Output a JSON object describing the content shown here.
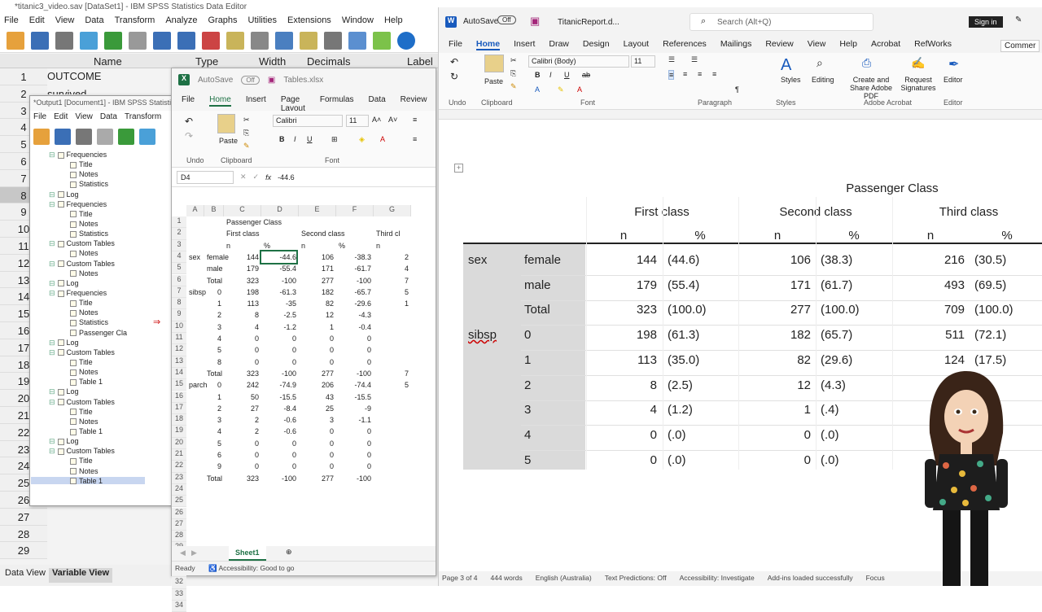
{
  "spss": {
    "title": "*titanic3_video.sav [DataSet1] - IBM SPSS Statistics Data Editor",
    "menu": [
      "File",
      "Edit",
      "View",
      "Data",
      "Transform",
      "Analyze",
      "Graphs",
      "Utilities",
      "Extensions",
      "Window",
      "Help"
    ],
    "columns": [
      "Name",
      "Type",
      "Width",
      "Decimals",
      "Label"
    ],
    "row_numbers": [
      "1",
      "2",
      "3",
      "4",
      "5",
      "6",
      "7",
      "8",
      "9",
      "10",
      "11",
      "12",
      "13",
      "14",
      "15",
      "16",
      "17",
      "18",
      "19",
      "20",
      "21",
      "22",
      "23",
      "24",
      "25",
      "26",
      "27",
      "28",
      "29"
    ],
    "cell_r1": "OUTCOME",
    "cell_r2": "survived",
    "tabs": [
      "Data View",
      "Variable View"
    ]
  },
  "viewer": {
    "title": "*Output1 [Document1] - IBM SPSS Statistics",
    "menu": [
      "File",
      "Edit",
      "View",
      "Data",
      "Transform"
    ],
    "tree": [
      {
        "label": "Frequencies",
        "level": 1
      },
      {
        "label": "Title",
        "level": 2
      },
      {
        "label": "Notes",
        "level": 2
      },
      {
        "label": "Statistics",
        "level": 2
      },
      {
        "label": "Log",
        "level": 1
      },
      {
        "label": "Frequencies",
        "level": 1
      },
      {
        "label": "Title",
        "level": 2
      },
      {
        "label": "Notes",
        "level": 2
      },
      {
        "label": "Statistics",
        "level": 2
      },
      {
        "label": "Custom Tables",
        "level": 1
      },
      {
        "label": "Notes",
        "level": 2
      },
      {
        "label": "Custom Tables",
        "level": 1
      },
      {
        "label": "Notes",
        "level": 2
      },
      {
        "label": "Log",
        "level": 1
      },
      {
        "label": "Frequencies",
        "level": 1
      },
      {
        "label": "Title",
        "level": 2
      },
      {
        "label": "Notes",
        "level": 2
      },
      {
        "label": "Statistics",
        "level": 2
      },
      {
        "label": "Passenger Cla",
        "level": 2
      },
      {
        "label": "Log",
        "level": 1
      },
      {
        "label": "Custom Tables",
        "level": 1
      },
      {
        "label": "Title",
        "level": 2
      },
      {
        "label": "Notes",
        "level": 2
      },
      {
        "label": "Table 1",
        "level": 2
      },
      {
        "label": "Log",
        "level": 1
      },
      {
        "label": "Custom Tables",
        "level": 1
      },
      {
        "label": "Title",
        "level": 2
      },
      {
        "label": "Notes",
        "level": 2
      },
      {
        "label": "Table 1",
        "level": 2
      },
      {
        "label": "Log",
        "level": 1
      },
      {
        "label": "Custom Tables",
        "level": 1
      },
      {
        "label": "Title",
        "level": 2
      },
      {
        "label": "Notes",
        "level": 2
      },
      {
        "label": "Table 1",
        "level": 2
      }
    ]
  },
  "excel": {
    "autosave": "AutoSave",
    "autosave_state": "Off",
    "filename": "Tables.xlsx",
    "menu": [
      "File",
      "Home",
      "Insert",
      "Page Layout",
      "Formulas",
      "Data",
      "Review"
    ],
    "font": "Calibri",
    "size": "11",
    "groups": [
      "Undo",
      "Clipboard",
      "Font"
    ],
    "paste": "Paste",
    "namebox": "D4",
    "formula": "-44.6",
    "columns": [
      "A",
      "B",
      "C",
      "D",
      "E",
      "F",
      "G"
    ],
    "rows": [
      [
        "",
        "",
        "Passenger Class",
        "",
        "",
        "",
        ""
      ],
      [
        "",
        "",
        "First class",
        "",
        "Second class",
        "",
        "Third cl"
      ],
      [
        "",
        "",
        "n",
        "%",
        "n",
        "%",
        "n"
      ],
      [
        "sex",
        "female",
        "144",
        "-44.6",
        "106",
        "-38.3",
        "2"
      ],
      [
        "",
        "male",
        "179",
        "-55.4",
        "171",
        "-61.7",
        "4"
      ],
      [
        "",
        "Total",
        "323",
        "-100",
        "277",
        "-100",
        "7"
      ],
      [
        "sibsp",
        "0",
        "198",
        "-61.3",
        "182",
        "-65.7",
        "5"
      ],
      [
        "",
        "1",
        "113",
        "-35",
        "82",
        "-29.6",
        "1"
      ],
      [
        "",
        "2",
        "8",
        "-2.5",
        "12",
        "-4.3",
        ""
      ],
      [
        "",
        "3",
        "4",
        "-1.2",
        "1",
        "-0.4",
        ""
      ],
      [
        "",
        "4",
        "0",
        "0",
        "0",
        "0",
        ""
      ],
      [
        "",
        "5",
        "0",
        "0",
        "0",
        "0",
        ""
      ],
      [
        "",
        "8",
        "0",
        "0",
        "0",
        "0",
        ""
      ],
      [
        "",
        "Total",
        "323",
        "-100",
        "277",
        "-100",
        "7"
      ],
      [
        "parch",
        "0",
        "242",
        "-74.9",
        "206",
        "-74.4",
        "5"
      ],
      [
        "",
        "1",
        "50",
        "-15.5",
        "43",
        "-15.5",
        ""
      ],
      [
        "",
        "2",
        "27",
        "-8.4",
        "25",
        "-9",
        ""
      ],
      [
        "",
        "3",
        "2",
        "-0.6",
        "3",
        "-1.1",
        ""
      ],
      [
        "",
        "4",
        "2",
        "-0.6",
        "0",
        "0",
        ""
      ],
      [
        "",
        "5",
        "0",
        "0",
        "0",
        "0",
        ""
      ],
      [
        "",
        "6",
        "0",
        "0",
        "0",
        "0",
        ""
      ],
      [
        "",
        "9",
        "0",
        "0",
        "0",
        "0",
        ""
      ],
      [
        "",
        "Total",
        "323",
        "-100",
        "277",
        "-100",
        ""
      ],
      [
        "",
        "",
        "",
        "",
        "",
        "",
        ""
      ],
      [
        "",
        "",
        "",
        "",
        "",
        "",
        ""
      ],
      [
        "",
        "",
        "",
        "",
        "",
        "",
        ""
      ],
      [
        "",
        "",
        "",
        "",
        "",
        "",
        ""
      ],
      [
        "",
        "",
        "",
        "",
        "",
        "",
        ""
      ],
      [
        "",
        "",
        "",
        "",
        "",
        "",
        ""
      ],
      [
        "",
        "",
        "",
        "",
        "",
        "",
        ""
      ],
      [
        "",
        "",
        "",
        "",
        "",
        "",
        ""
      ],
      [
        "",
        "",
        "",
        "",
        "",
        "",
        ""
      ],
      [
        "",
        "",
        "",
        "",
        "",
        "",
        ""
      ],
      [
        "",
        "",
        "",
        "",
        "",
        "",
        ""
      ]
    ],
    "sheet": "Sheet1",
    "status_ready": "Ready",
    "status_access": "Accessibility: Good to go"
  },
  "word": {
    "autosave": "AutoSave",
    "autosave_state": "Off",
    "filename": "TitanicReport.d...",
    "search_placeholder": "Search (Alt+Q)",
    "signin": "Sign in",
    "menu": [
      "File",
      "Home",
      "Insert",
      "Draw",
      "Design",
      "Layout",
      "References",
      "Mailings",
      "Review",
      "View",
      "Help",
      "Acrobat",
      "RefWorks"
    ],
    "comments": "Commer",
    "font": "Calibri (Body)",
    "size": "11",
    "groups": [
      "Undo",
      "Clipboard",
      "Font",
      "Paragraph",
      "Styles",
      "Adobe Acrobat",
      "Editor"
    ],
    "paste": "Paste",
    "styles": "Styles",
    "editing": "Editing",
    "create_share": "Create and Share Adobe PDF",
    "request_sig": "Request Signatures",
    "editor": "Editor",
    "table": {
      "header": "Passenger Class",
      "classes": [
        "First class",
        "Second class",
        "Third class"
      ],
      "subcols": [
        "n",
        "%",
        "n",
        "%",
        "n",
        "%"
      ],
      "rows": [
        {
          "var": "sex",
          "cat": "female",
          "v": [
            "144",
            "(44.6)",
            "106",
            "(38.3)",
            "216",
            "(30.5)"
          ]
        },
        {
          "var": "",
          "cat": "male",
          "v": [
            "179",
            "(55.4)",
            "171",
            "(61.7)",
            "493",
            "(69.5)"
          ]
        },
        {
          "var": "",
          "cat": "Total",
          "v": [
            "323",
            "(100.0)",
            "277",
            "(100.0)",
            "709",
            "(100.0)"
          ]
        },
        {
          "var": "sibsp",
          "cat": "0",
          "v": [
            "198",
            "(61.3)",
            "182",
            "(65.7)",
            "511",
            "(72.1)"
          ]
        },
        {
          "var": "",
          "cat": "1",
          "v": [
            "113",
            "(35.0)",
            "82",
            "(29.6)",
            "124",
            "(17.5)"
          ]
        },
        {
          "var": "",
          "cat": "2",
          "v": [
            "8",
            "(2.5)",
            "12",
            "(4.3)",
            "",
            ""
          ]
        },
        {
          "var": "",
          "cat": "3",
          "v": [
            "4",
            "(1.2)",
            "1",
            "(.4)",
            "",
            ""
          ]
        },
        {
          "var": "",
          "cat": "4",
          "v": [
            "0",
            "(.0)",
            "0",
            "(.0)",
            "",
            ""
          ]
        },
        {
          "var": "",
          "cat": "5",
          "v": [
            "0",
            "(.0)",
            "0",
            "(.0)",
            "",
            ""
          ]
        }
      ]
    },
    "status": [
      "Page 3 of 4",
      "444 words",
      "English (Australia)",
      "Text Predictions: Off",
      "Accessibility: Investigate",
      "Add-ins loaded successfully",
      "Focus"
    ]
  }
}
